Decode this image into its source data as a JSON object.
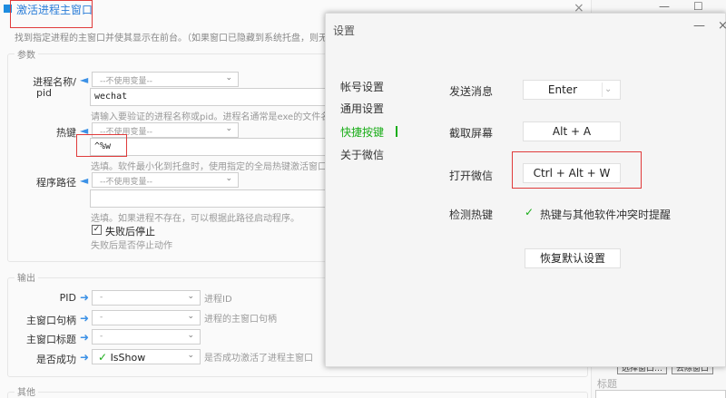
{
  "bg": {
    "title": "激活进程主窗口",
    "close": "×",
    "description": "找到指定进程的主窗口并使其显示在前台。（如果窗口已隐藏到系统托盘，则无",
    "params": {
      "group_label": "参数",
      "process_label": "进程名称/",
      "process_label2": "pid",
      "var_placeholder": "--不使用变量--",
      "process_value": "wechat",
      "process_hint": "请输入要验证的进程名称或pid。进程名通常是exe的文件名",
      "hotkey_label": "热键",
      "hotkey_value": "^%w",
      "hotkey_hint": "选填。软件最小化到托盘时，使用指定的全局热键激活窗口。",
      "path_label": "程序路径",
      "path_value": "",
      "path_hint": "选填。如果进程不存在，可以根据此路径启动程序。",
      "stop_on_fail": "失败后停止",
      "stop_on_fail_hint": "失败后是否停止动作"
    },
    "output": {
      "group_label": "输出",
      "pid_label": "PID",
      "pid_value": "-",
      "pid_desc": "进程ID",
      "handle_label": "主窗口句柄",
      "handle_value": "-",
      "handle_desc": "进程的主窗口句柄",
      "wtitle_label": "主窗口标题",
      "wtitle_value": "-",
      "success_label": "是否成功",
      "success_value": "IsShow",
      "success_desc": "是否成功激活了进程主窗口"
    },
    "other": {
      "group_label": "其他"
    }
  },
  "strip": {
    "min": "—",
    "max": "☐",
    "btn1": "选择窗口…",
    "btn2": "去除窗口",
    "label1": "标题",
    "label2": "…"
  },
  "settings": {
    "title": "设置",
    "min": "—",
    "close": "×",
    "nav": [
      "帐号设置",
      "通用设置",
      "快捷按键",
      "关于微信"
    ],
    "send_label": "发送消息",
    "send_value": "Enter",
    "capture_label": "截取屏幕",
    "capture_value": "Alt + A",
    "open_label": "打开微信",
    "open_value": "Ctrl + Alt + W",
    "detect_label": "检测热键",
    "detect_check": "✓",
    "detect_text": "热键与其他软件冲突时提醒",
    "reset_button": "恢复默认设置"
  }
}
